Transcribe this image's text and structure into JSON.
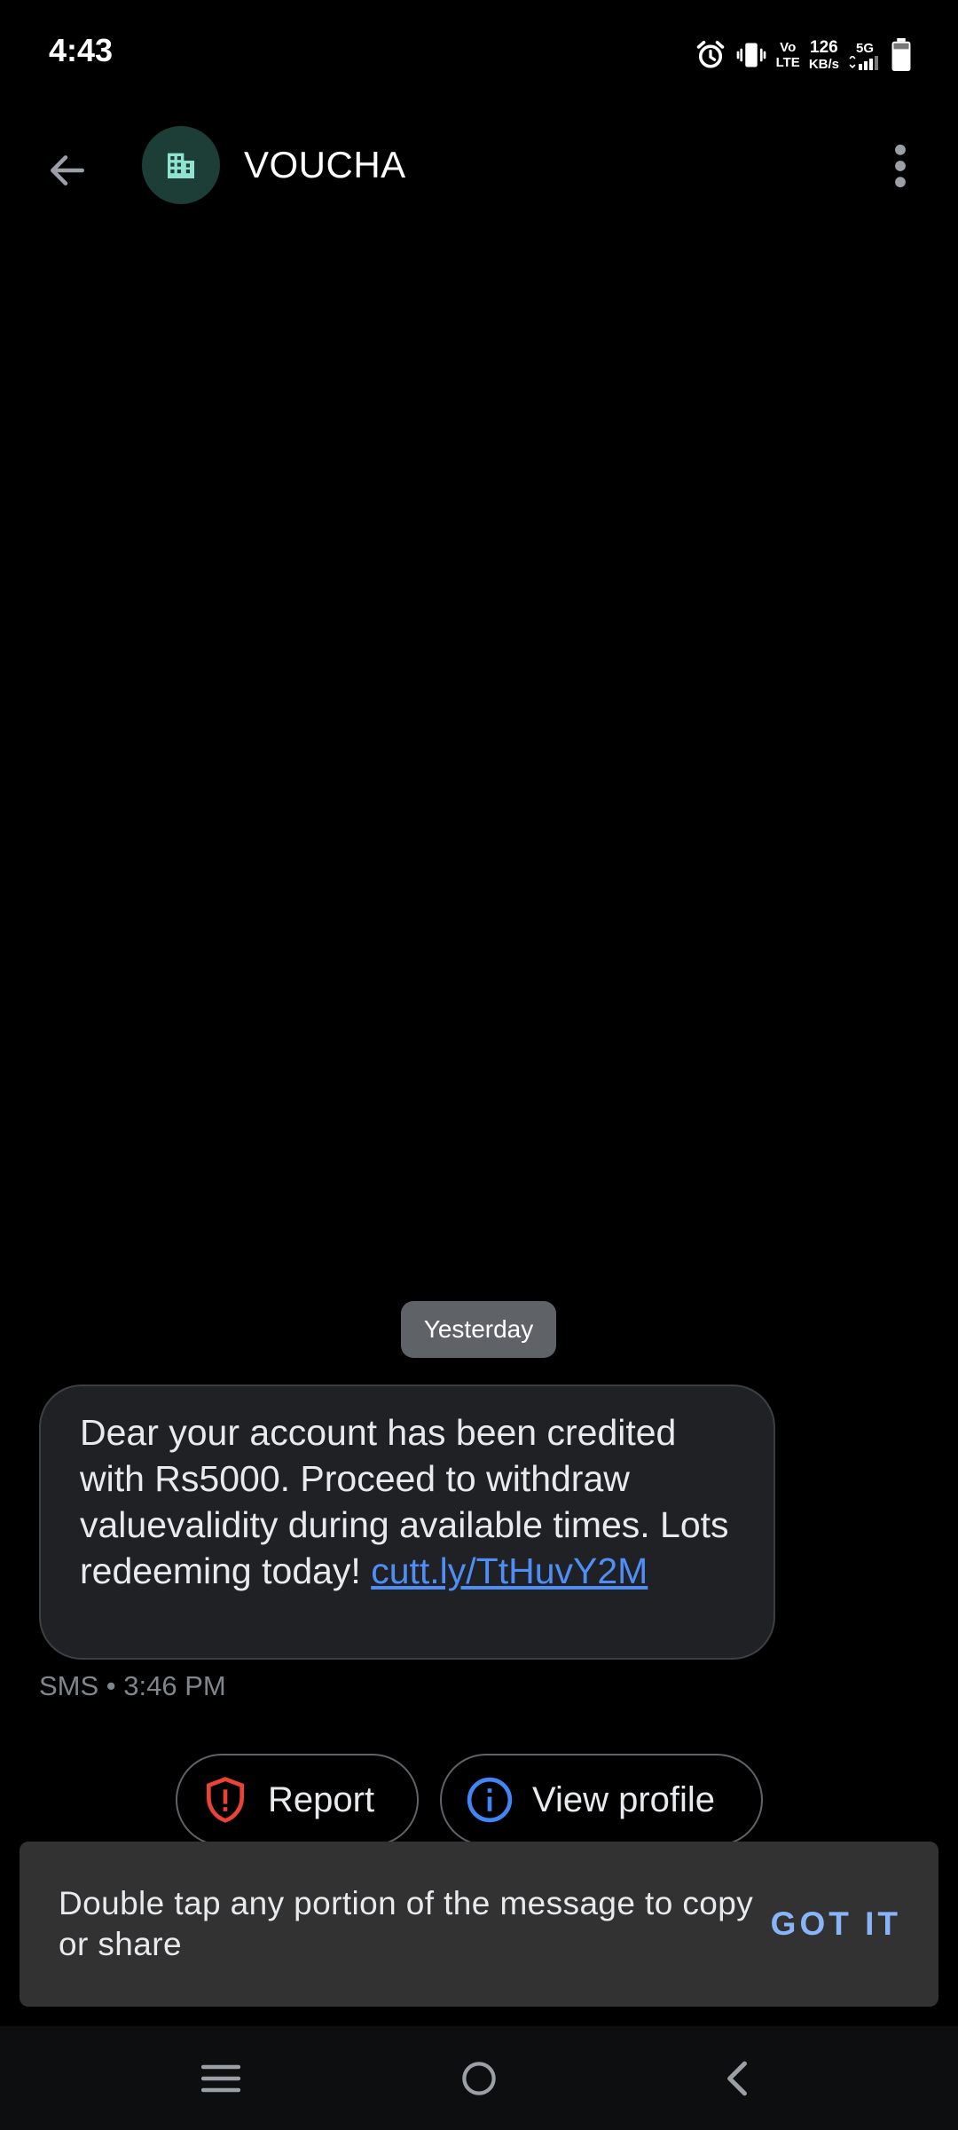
{
  "status_bar": {
    "time": "4:43",
    "volte_top": "Vo",
    "volte_bottom": "LTE",
    "speed_value": "126",
    "speed_unit": "KB/s",
    "network": "5G",
    "icons": [
      "alarm-icon",
      "vibrate-icon",
      "volte-indicator",
      "network-speed",
      "signal-icon",
      "battery-icon"
    ]
  },
  "app_bar": {
    "contact_name": "VOUCHA",
    "avatar_icon": "business-building-icon",
    "avatar_color": "#1d3d37",
    "avatar_icon_color": "#8fe3cf"
  },
  "conversation": {
    "date_separator": "Yesterday",
    "messages": [
      {
        "text": "Dear your account has been credited with Rs5000. Proceed to withdraw valuevalidity during available times. Lots redeeming today! ",
        "link": "cutt.ly/TtHuvY2M",
        "meta": "SMS • 3:46 PM"
      }
    ]
  },
  "actions": {
    "report_label": "Report",
    "view_profile_label": "View profile",
    "report_color": "#ea4335",
    "info_color": "#4285f4"
  },
  "snackbar": {
    "text": "Double tap any portion of the message to copy or share",
    "action": "GOT IT",
    "action_color": "#8ab4f8"
  },
  "nav_bar": {
    "icons": [
      "recents-icon",
      "home-icon",
      "back-nav-icon"
    ]
  }
}
